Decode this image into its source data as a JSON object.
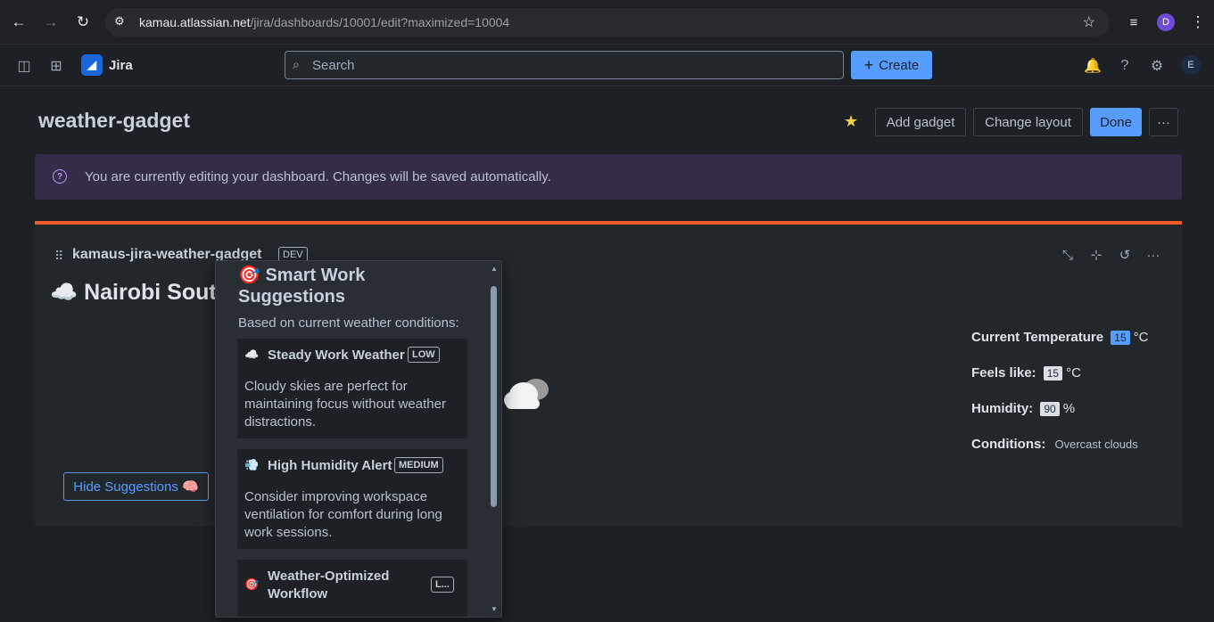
{
  "browser": {
    "url_host": "kamau.atlassian.net",
    "url_path": "/jira/dashboards/10001/edit?maximized=10004",
    "profile_initial": "D"
  },
  "topnav": {
    "app_name": "Jira",
    "search_placeholder": "Search",
    "create_label": "Create",
    "avatar_initial": "E"
  },
  "dashboard": {
    "title": "weather-gadget",
    "add_gadget_label": "Add gadget",
    "change_layout_label": "Change layout",
    "done_label": "Done",
    "more_label": "···"
  },
  "banner": {
    "message": "You are currently editing your dashboard. Changes will be saved automatically."
  },
  "gadget": {
    "title": "kamaus-jira-weather-gadget",
    "badge": "DEV",
    "city_emoji": "☁️",
    "city": "Nairobi South",
    "hide_label": "Hide Suggestions 🧠",
    "stats": {
      "temp_label": "Current Temperature",
      "temp_value": "15",
      "temp_unit": "°C",
      "feels_label": "Feels like:",
      "feels_value": "15",
      "feels_unit": "°C",
      "humidity_label": "Humidity:",
      "humidity_value": "90",
      "humidity_unit": "%",
      "conditions_label": "Conditions:",
      "conditions_value": "Overcast clouds"
    }
  },
  "suggestions": {
    "title": "🎯 Smart Work Suggestions",
    "subtitle": "Based on current weather conditions:",
    "cards": [
      {
        "emoji": "☁️",
        "title": "Steady Work Weather",
        "badge": "LOW",
        "desc": "Cloudy skies are perfect for maintaining focus without weather distractions."
      },
      {
        "emoji": "💨",
        "title": "High Humidity Alert",
        "badge": "MEDIUM",
        "desc": "Consider improving workspace ventilation for comfort during long work sessions."
      },
      {
        "emoji": "🎯",
        "title": "Weather-Optimized Workflow",
        "badge": "L..."
      }
    ]
  },
  "colors": {
    "accent": "#579dff",
    "gadget_border": "#f15b2b",
    "banner": "#352c4a"
  }
}
